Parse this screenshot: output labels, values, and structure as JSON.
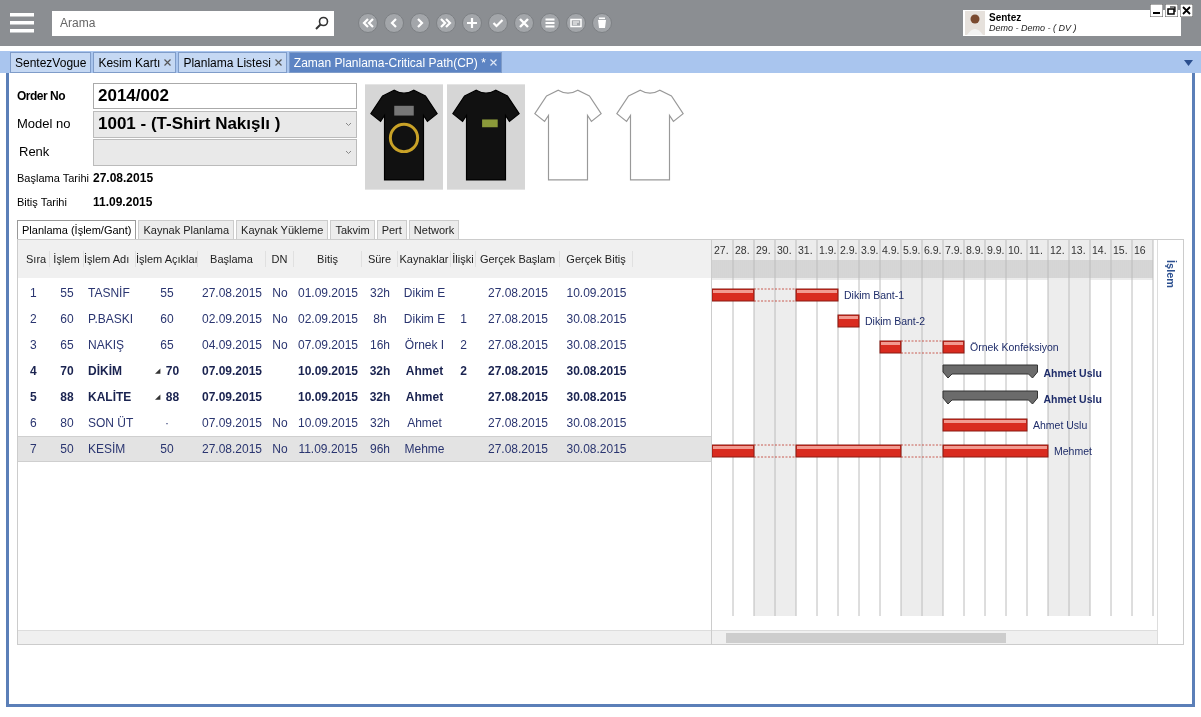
{
  "toolbar": {
    "search": {
      "placeholder": "Arama"
    }
  },
  "user": {
    "name": "Sentez",
    "detail": "Demo - Demo - ( DV )"
  },
  "tabs": [
    {
      "label": "SentezVogue",
      "closable": false,
      "selected": false
    },
    {
      "label": "Kesim Kartı",
      "closable": true,
      "selected": false
    },
    {
      "label": "Planlama Listesi",
      "closable": true,
      "selected": false
    },
    {
      "label": "Zaman Planlama-Critical Path(CP) *",
      "closable": true,
      "selected": true
    }
  ],
  "form": {
    "order_no": {
      "label": "Order No",
      "value": "2014/002"
    },
    "model_no": {
      "label": "Model no",
      "value": "1001 - (T-Shirt Nakışlı )"
    },
    "renk": {
      "label": "Renk"
    },
    "start": {
      "label": "Başlama Tarihi",
      "value": "27.08.2015"
    },
    "end": {
      "label": "Bitiş Tarihi",
      "value": "11.09.2015"
    }
  },
  "sub_tabs": [
    {
      "label": "Planlama (İşlem/Gant)",
      "selected": true
    },
    {
      "label": "Kaynak Planlama",
      "selected": false
    },
    {
      "label": "Kaynak Yükleme",
      "selected": false
    },
    {
      "label": "Takvim",
      "selected": false
    },
    {
      "label": "Pert",
      "selected": false
    },
    {
      "label": "Network",
      "selected": false
    }
  ],
  "table": {
    "columns": [
      "Sıra",
      "İşlem",
      "İşlem Adı",
      "İşlem Açıklar",
      "Başlama",
      "DN",
      "Bitiş",
      "Süre",
      "Kaynaklar",
      "İlişki",
      "Gerçek Başlam",
      "Gerçek Bitiş"
    ],
    "rows": [
      {
        "bold": false,
        "selected": false,
        "expander": "",
        "cells": [
          "1",
          "55",
          "TASNİF",
          "55",
          "27.08.2015",
          "No",
          "01.09.2015",
          "32h",
          "Dikim E",
          "",
          "27.08.2015",
          "10.09.2015"
        ]
      },
      {
        "bold": false,
        "selected": false,
        "expander": "",
        "cells": [
          "2",
          "60",
          "P.BASKI",
          "60",
          "02.09.2015",
          "No",
          "02.09.2015",
          "8h",
          "Dikim E",
          "1",
          "27.08.2015",
          "30.08.2015"
        ]
      },
      {
        "bold": false,
        "selected": false,
        "expander": "",
        "cells": [
          "3",
          "65",
          "NAKIŞ",
          "65",
          "04.09.2015",
          "No",
          "07.09.2015",
          "16h",
          "Örnek I",
          "2",
          "27.08.2015",
          "30.08.2015"
        ]
      },
      {
        "bold": true,
        "selected": false,
        "expander": "◢",
        "cells": [
          "4",
          "70",
          "DİKİM",
          "70",
          "07.09.2015",
          "",
          "10.09.2015",
          "32h",
          "Ahmet",
          "2",
          "27.08.2015",
          "30.08.2015"
        ]
      },
      {
        "bold": true,
        "selected": false,
        "expander": "◢",
        "cells": [
          "5",
          "88",
          "KALİTE",
          "88",
          "07.09.2015",
          "",
          "10.09.2015",
          "32h",
          "Ahmet",
          "",
          "27.08.2015",
          "30.08.2015"
        ]
      },
      {
        "bold": false,
        "selected": false,
        "expander": "",
        "cells": [
          "6",
          "80",
          "SON ÜT",
          "·",
          "07.09.2015",
          "No",
          "10.09.2015",
          "32h",
          "Ahmet",
          "",
          "27.08.2015",
          "30.08.2015"
        ]
      },
      {
        "bold": false,
        "selected": true,
        "expander": "",
        "cells": [
          "7",
          "50",
          "KESİM",
          "50",
          "27.08.2015",
          "No",
          "11.09.2015",
          "96h",
          "Mehme",
          "",
          "27.08.2015",
          "30.08.2015"
        ]
      }
    ]
  },
  "gantt": {
    "days": [
      {
        "label": "27.",
        "weekend": false
      },
      {
        "label": "28.",
        "weekend": false
      },
      {
        "label": "29.",
        "weekend": true
      },
      {
        "label": "30.",
        "weekend": true
      },
      {
        "label": "31.",
        "weekend": false
      },
      {
        "label": "1.9.",
        "weekend": false
      },
      {
        "label": "2.9.",
        "weekend": false
      },
      {
        "label": "3.9.",
        "weekend": false
      },
      {
        "label": "4.9.",
        "weekend": false
      },
      {
        "label": "5.9.",
        "weekend": true
      },
      {
        "label": "6.9.",
        "weekend": true
      },
      {
        "label": "7.9.",
        "weekend": false
      },
      {
        "label": "8.9.",
        "weekend": false
      },
      {
        "label": "9.9.",
        "weekend": false
      },
      {
        "label": "10.",
        "weekend": false
      },
      {
        "label": "11.",
        "weekend": false
      },
      {
        "label": "12.",
        "weekend": true
      },
      {
        "label": "13.",
        "weekend": true
      },
      {
        "label": "14.",
        "weekend": false
      },
      {
        "label": "15.",
        "weekend": false
      },
      {
        "label": "16",
        "weekend": false
      }
    ],
    "rows": [
      {
        "kind": "task",
        "label": "Dikim Bant-1",
        "cells": [
          {
            "kind": "bar"
          },
          {
            "kind": "bar"
          },
          {
            "kind": "gap"
          },
          {
            "kind": "gap"
          },
          {
            "kind": "bar"
          },
          {
            "kind": "bar"
          },
          {
            "kind": "none"
          },
          {
            "kind": "none"
          },
          {
            "kind": "none"
          },
          {
            "kind": "none"
          },
          {
            "kind": "none"
          },
          {
            "kind": "none"
          },
          {
            "kind": "none"
          },
          {
            "kind": "none"
          },
          {
            "kind": "none"
          },
          {
            "kind": "none"
          },
          {
            "kind": "none"
          },
          {
            "kind": "none"
          },
          {
            "kind": "none"
          },
          {
            "kind": "none"
          },
          {
            "kind": "none"
          }
        ]
      },
      {
        "kind": "task",
        "label": "Dikim Bant-2",
        "cells": [
          {
            "kind": "none"
          },
          {
            "kind": "none"
          },
          {
            "kind": "none"
          },
          {
            "kind": "none"
          },
          {
            "kind": "none"
          },
          {
            "kind": "none"
          },
          {
            "kind": "bar"
          },
          {
            "kind": "none"
          },
          {
            "kind": "none"
          },
          {
            "kind": "none"
          },
          {
            "kind": "none"
          },
          {
            "kind": "none"
          },
          {
            "kind": "none"
          },
          {
            "kind": "none"
          },
          {
            "kind": "none"
          },
          {
            "kind": "none"
          },
          {
            "kind": "none"
          },
          {
            "kind": "none"
          },
          {
            "kind": "none"
          },
          {
            "kind": "none"
          },
          {
            "kind": "none"
          }
        ]
      },
      {
        "kind": "task",
        "label": "Örnek Konfeksiyon",
        "cells": [
          {
            "kind": "none"
          },
          {
            "kind": "none"
          },
          {
            "kind": "none"
          },
          {
            "kind": "none"
          },
          {
            "kind": "none"
          },
          {
            "kind": "none"
          },
          {
            "kind": "none"
          },
          {
            "kind": "none"
          },
          {
            "kind": "bar"
          },
          {
            "kind": "gap"
          },
          {
            "kind": "gap"
          },
          {
            "kind": "bar"
          },
          {
            "kind": "none"
          },
          {
            "kind": "none"
          },
          {
            "kind": "none"
          },
          {
            "kind": "none"
          },
          {
            "kind": "none"
          },
          {
            "kind": "none"
          },
          {
            "kind": "none"
          },
          {
            "kind": "none"
          },
          {
            "kind": "none"
          }
        ]
      },
      {
        "kind": "summary",
        "label": "Ahmet Uslu",
        "cells": [
          {
            "kind": "none"
          },
          {
            "kind": "none"
          },
          {
            "kind": "none"
          },
          {
            "kind": "none"
          },
          {
            "kind": "none"
          },
          {
            "kind": "none"
          },
          {
            "kind": "none"
          },
          {
            "kind": "none"
          },
          {
            "kind": "none"
          },
          {
            "kind": "none"
          },
          {
            "kind": "none"
          },
          {
            "kind": "summary"
          },
          {
            "kind": "summary"
          },
          {
            "kind": "summary"
          },
          {
            "kind": "summary"
          },
          {
            "kind": "summary"
          },
          {
            "kind": "none"
          },
          {
            "kind": "none"
          },
          {
            "kind": "none"
          },
          {
            "kind": "none"
          },
          {
            "kind": "none"
          }
        ]
      },
      {
        "kind": "summary",
        "label": "Ahmet Uslu",
        "cells": [
          {
            "kind": "none"
          },
          {
            "kind": "none"
          },
          {
            "kind": "none"
          },
          {
            "kind": "none"
          },
          {
            "kind": "none"
          },
          {
            "kind": "none"
          },
          {
            "kind": "none"
          },
          {
            "kind": "none"
          },
          {
            "kind": "none"
          },
          {
            "kind": "none"
          },
          {
            "kind": "none"
          },
          {
            "kind": "summary"
          },
          {
            "kind": "summary"
          },
          {
            "kind": "summary"
          },
          {
            "kind": "summary"
          },
          {
            "kind": "summary"
          },
          {
            "kind": "none"
          },
          {
            "kind": "none"
          },
          {
            "kind": "none"
          },
          {
            "kind": "none"
          },
          {
            "kind": "none"
          }
        ]
      },
      {
        "kind": "task",
        "label": "Ahmet Uslu",
        "cells": [
          {
            "kind": "none"
          },
          {
            "kind": "none"
          },
          {
            "kind": "none"
          },
          {
            "kind": "none"
          },
          {
            "kind": "none"
          },
          {
            "kind": "none"
          },
          {
            "kind": "none"
          },
          {
            "kind": "none"
          },
          {
            "kind": "none"
          },
          {
            "kind": "none"
          },
          {
            "kind": "none"
          },
          {
            "kind": "bar"
          },
          {
            "kind": "bar"
          },
          {
            "kind": "bar"
          },
          {
            "kind": "bar"
          },
          {
            "kind": "none"
          },
          {
            "kind": "none"
          },
          {
            "kind": "none"
          },
          {
            "kind": "none"
          },
          {
            "kind": "none"
          },
          {
            "kind": "none"
          }
        ]
      },
      {
        "kind": "task",
        "label": "Mehmet",
        "cells": [
          {
            "kind": "bar"
          },
          {
            "kind": "bar"
          },
          {
            "kind": "gap"
          },
          {
            "kind": "gap"
          },
          {
            "kind": "bar"
          },
          {
            "kind": "bar"
          },
          {
            "kind": "bar"
          },
          {
            "kind": "bar"
          },
          {
            "kind": "bar"
          },
          {
            "kind": "gap"
          },
          {
            "kind": "gap"
          },
          {
            "kind": "bar"
          },
          {
            "kind": "bar"
          },
          {
            "kind": "bar"
          },
          {
            "kind": "bar"
          },
          {
            "kind": "bar"
          },
          {
            "kind": "none"
          },
          {
            "kind": "none"
          },
          {
            "kind": "none"
          },
          {
            "kind": "none"
          },
          {
            "kind": "none"
          }
        ]
      }
    ],
    "side_label": "İşlem"
  }
}
